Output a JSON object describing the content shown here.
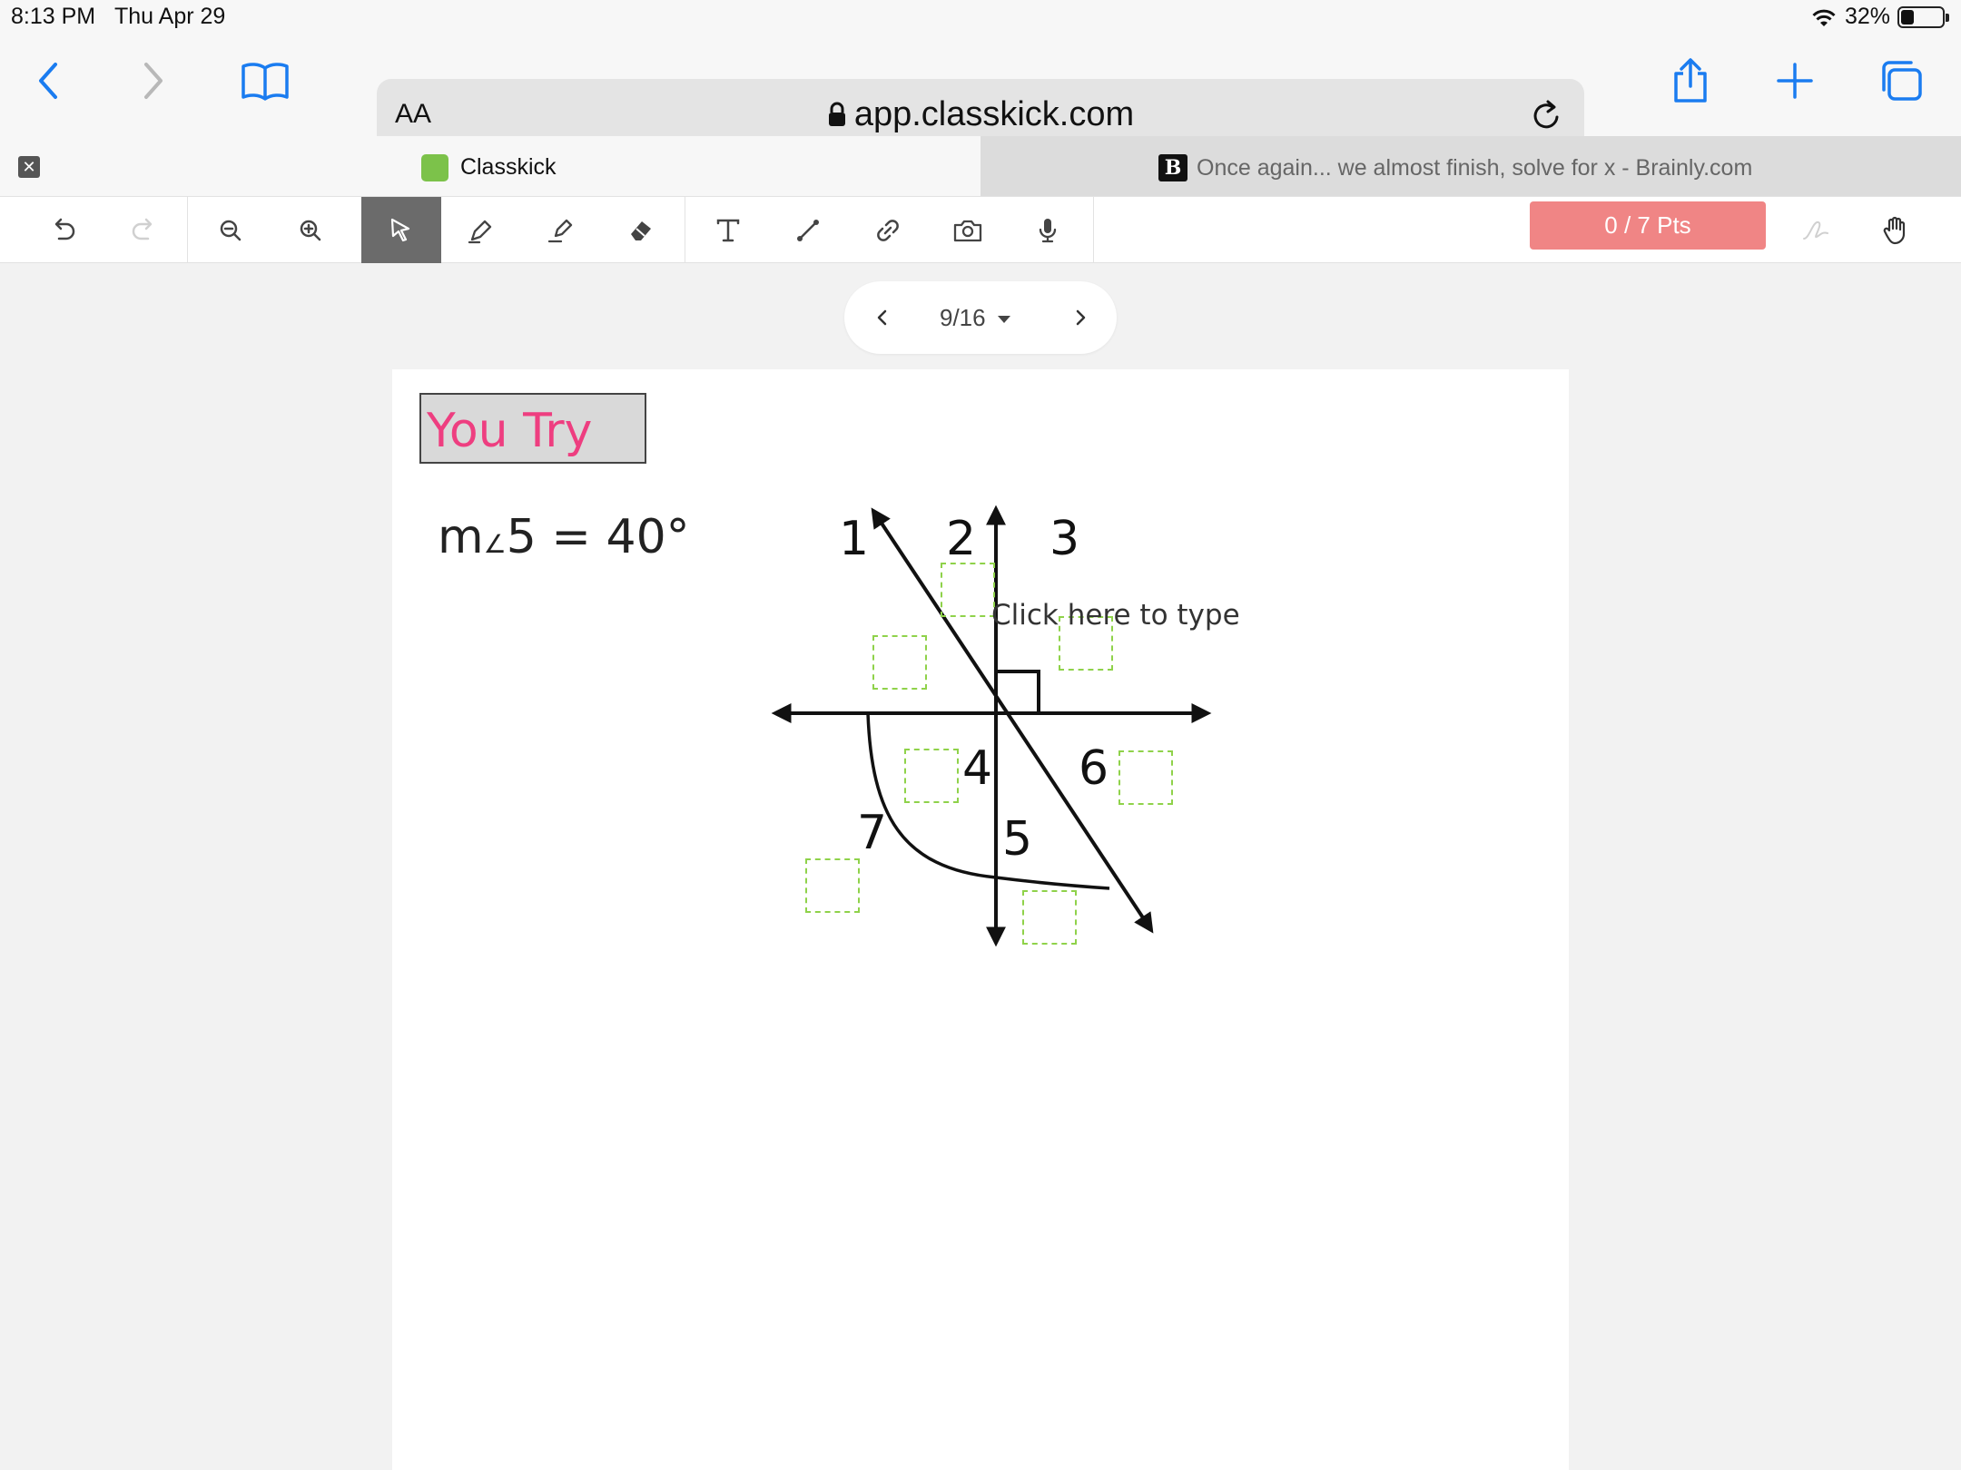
{
  "status_bar": {
    "time": "8:13 PM",
    "date": "Thu Apr 29",
    "battery": "32%",
    "battery_level": 0.32
  },
  "browser": {
    "text_size_label": "AA",
    "url": "app.classkick.com",
    "tabs": [
      {
        "title": "Classkick",
        "active": true
      },
      {
        "title": "Once again... we almost finish, solve for x - Brainly.com",
        "active": false
      }
    ]
  },
  "toolbar": {
    "tools": [
      "undo-icon",
      "redo-icon",
      "zoom-out-icon",
      "zoom-in-icon",
      "pointer-icon",
      "pen-icon",
      "highlighter-icon",
      "eraser-icon",
      "text-icon",
      "line-icon",
      "link-icon",
      "camera-icon",
      "microphone-icon"
    ],
    "active_tool": "pointer-icon",
    "points_label": "0 / 7 Pts",
    "points_color": "#f08585"
  },
  "page_nav": {
    "label": "9/16"
  },
  "worksheet": {
    "title": "You Try",
    "title_color": "#ee3e80",
    "equation_prefix": "m",
    "equation_angle": "∠",
    "equation_rest": "5 = 40°",
    "placeholder": "Click here to type",
    "angle_labels": [
      "1",
      "2",
      "3",
      "4",
      "5",
      "6",
      "7"
    ],
    "answer_box_color": "#8fd24a"
  }
}
